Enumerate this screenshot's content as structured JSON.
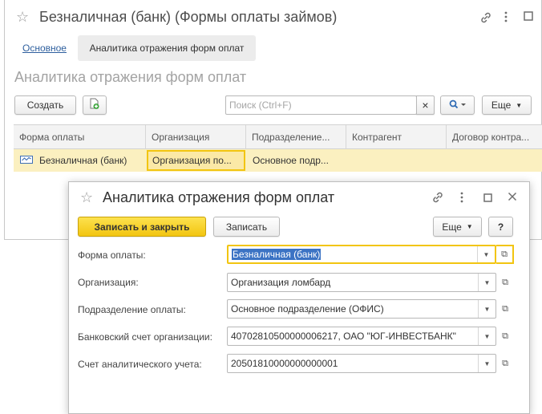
{
  "main_window": {
    "title": "Безналичная (банк) (Формы оплаты займов)",
    "tabs": [
      {
        "label": "Основное"
      },
      {
        "label": "Аналитика отражения форм оплат"
      }
    ],
    "section_title": "Аналитика отражения форм оплат",
    "toolbar": {
      "create_label": "Создать",
      "search_placeholder": "Поиск (Ctrl+F)",
      "search_clear": "×",
      "more_label": "Еще"
    },
    "table": {
      "columns": [
        "Форма оплаты",
        "Организация",
        "Подразделение...",
        "Контрагент",
        "Договор контра..."
      ],
      "rows": [
        {
          "form": "Безналичная (банк)",
          "organization": "Организация по...",
          "department": "Основное подр...",
          "counterparty": "",
          "contract": ""
        }
      ]
    }
  },
  "dialog": {
    "title": "Аналитика отражения форм оплат",
    "buttons": {
      "save_close": "Записать и закрыть",
      "save": "Записать",
      "more": "Еще",
      "help": "?"
    },
    "fields": [
      {
        "label": "Форма оплаты:",
        "value": "Безналичная (банк)"
      },
      {
        "label": "Организация:",
        "value": "Организация ломбард"
      },
      {
        "label": "Подразделение оплаты:",
        "value": "Основное подразделение (ОФИС)"
      },
      {
        "label": "Банковский счет организации:",
        "value": "40702810500000006217, ОАО \"ЮГ-ИНВЕСТБАНК\""
      },
      {
        "label": "Счет аналитического учета:",
        "value": "20501810000000000001"
      }
    ]
  },
  "colors": {
    "accent_yellow": "#f2c511",
    "selected_row": "#fbf0c0",
    "link_blue": "#2e5f9e",
    "selection_blue": "#3b73c4"
  }
}
